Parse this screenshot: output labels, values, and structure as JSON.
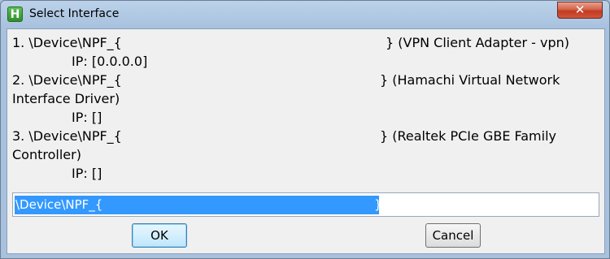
{
  "window": {
    "title": "Select Interface",
    "app_icon_letter": "H",
    "close_glyph": "✕"
  },
  "interfaces": [
    {
      "name": "1. \\Device\\NPF_{",
      "desc": "} (VPN Client Adapter - vpn)",
      "desc_cont": "",
      "ip": "IP: [0.0.0.0]"
    },
    {
      "name": "2. \\Device\\NPF_{",
      "desc": "} (Hamachi Virtual Network",
      "desc_cont": "Interface Driver)",
      "ip": "IP: []"
    },
    {
      "name": "3. \\Device\\NPF_{",
      "desc": "} (Realtek PCIe GBE Family",
      "desc_cont": "Controller)",
      "ip": "IP: []"
    }
  ],
  "input": {
    "value_start": "\\Device\\NPF_{",
    "value_end": "}"
  },
  "buttons": {
    "ok": "OK",
    "cancel": "Cancel"
  }
}
